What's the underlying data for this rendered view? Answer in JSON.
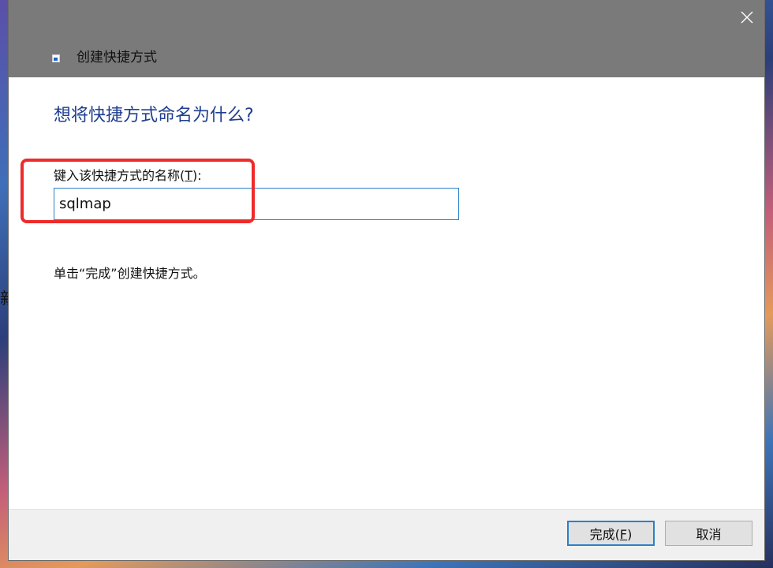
{
  "window": {
    "title": "创建快捷方式"
  },
  "main": {
    "heading": "想将快捷方式命名为什么?",
    "field_label_prefix": "键入该快捷方式的名称(",
    "field_label_key": "T",
    "field_label_suffix": "):",
    "name_value": "sqlmap",
    "instruction": "单击“完成”创建快捷方式。"
  },
  "buttons": {
    "finish_prefix": "完成(",
    "finish_key": "F",
    "finish_suffix": ")",
    "cancel": "取消"
  },
  "desktop": {
    "partial_text": "新"
  },
  "annotation": {
    "highlight_color": "#ee2b2b"
  },
  "icons": {
    "close": "close-icon",
    "shortcut": "shortcut-icon"
  }
}
